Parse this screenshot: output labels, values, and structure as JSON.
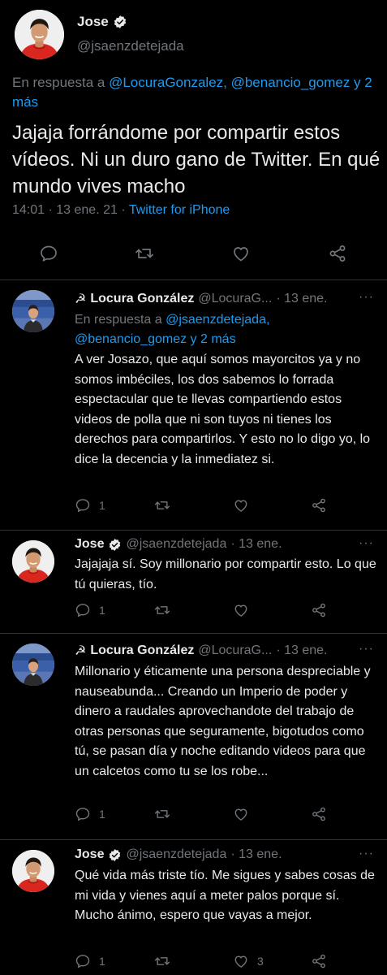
{
  "main_tweet": {
    "name": "Jose",
    "handle": "@jsaenzdetejada",
    "reply_prefix": "En respuesta a",
    "reply_mentions": "@LocuraGonzalez, @benancio_gomez y 2 más",
    "text": "Jajaja forrándome por compartir estos vídeos. Ni un duro gano de Twitter. En qué mundo vives macho",
    "time": "14:01 · 13 ene. 21 ·",
    "source": "Twitter for iPhone",
    "icons": [
      "reply-icon",
      "retweet-icon",
      "like-icon",
      "share-icon"
    ]
  },
  "replies": [
    {
      "name": "Locura González",
      "name_prefix": "☭",
      "handle": "@LocuraG...",
      "date": "· 13 ene.",
      "reply_prefix": "En respuesta a",
      "reply_mentions": "@jsaenzdetejada, @benancio_gomez y 2 más",
      "text": "A ver Josazo, que aquí somos mayorcitos ya y no somos imbéciles, los dos sabemos lo forrada espectacular que te llevas compartiendo estos videos de polla que ni son tuyos ni tienes los derechos para compartirlos. Y esto no lo digo yo, lo dice la decencia y la inmediatez si.",
      "reply_count": "1",
      "like_count": ""
    },
    {
      "name": "Jose",
      "handle": "@jsaenzdetejada",
      "date": "· 13 ene.",
      "text": "Jajajaja sí. Soy millonario por compartir esto. Lo que tú quieras, tío.",
      "reply_count": "1",
      "like_count": ""
    },
    {
      "name": "Locura González",
      "name_prefix": "☭",
      "handle": "@LocuraG...",
      "date": "· 13 ene.",
      "text": "Millonario y éticamente una persona despreciable y nauseabunda... Creando un Imperio de poder y dinero a raudales aprovechandote del trabajo de otras personas que seguramente, bigotudos como tú, se pasan día y noche editando videos para que un calcetos como tu se los robe...",
      "reply_count": "1",
      "like_count": ""
    },
    {
      "name": "Jose",
      "handle": "@jsaenzdetejada",
      "date": "· 13 ene.",
      "text": "Qué vida más triste tío. Me sigues y sabes cosas de mi vida y vienes aquí a meter palos porque sí. Mucho ánimo, espero que vayas a mejor.",
      "reply_count": "1",
      "like_count": "3"
    }
  ],
  "more_label": "···",
  "colors": {
    "background": "#000000",
    "text": "#e7e9ea",
    "muted": "#71767b",
    "link": "#1d9bf0",
    "divider": "#2f3336"
  }
}
